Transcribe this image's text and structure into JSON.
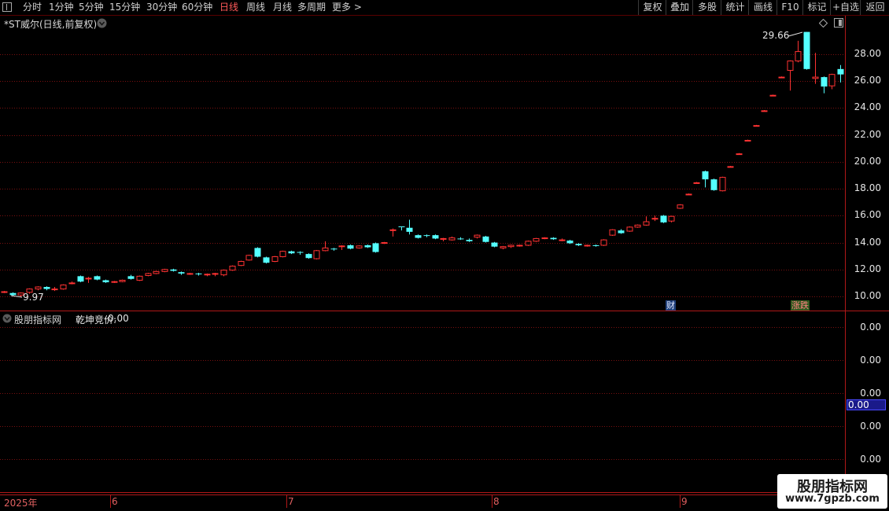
{
  "toolbar": {
    "periods": [
      "分时",
      "1分钟",
      "5分钟",
      "15分钟",
      "30分钟",
      "60分钟",
      "日线",
      "周线",
      "月线",
      "多周期",
      "更多 >"
    ],
    "active_period": "日线",
    "right_buttons": [
      "复权",
      "叠加",
      "多股",
      "统计",
      "画线",
      "F10",
      "标记",
      "+自选",
      "返回"
    ]
  },
  "main_chart": {
    "title": "*ST威尔(日线,前复权)",
    "price_axis": [
      "28.00",
      "26.00",
      "24.00",
      "22.00",
      "20.00",
      "18.00",
      "16.00",
      "14.00",
      "12.00",
      "10.00"
    ],
    "high_marker": "29.66",
    "low_marker": "9.97",
    "badge_finance": "财",
    "badge_limit": "涨跌"
  },
  "indicator_panel": {
    "title": "股朋指标网",
    "indicator_name": "乾坤竞价:",
    "indicator_value": "0.00",
    "axis_values": [
      "0.00",
      "0.00",
      "0.00",
      "0.00",
      "0.00"
    ],
    "current_value": "0.00"
  },
  "time_axis": {
    "labels": [
      "2025年",
      "6",
      "7",
      "8",
      "9"
    ]
  },
  "watermark": {
    "title": "股朋指标网",
    "url": "www.7gpzb.com"
  },
  "colors": {
    "up": "#ff3232",
    "down": "#54ffff",
    "grid": "#7a1010",
    "background": "#000000"
  },
  "candles": [
    [
      10.3,
      10.35,
      10.25,
      10.4
    ],
    [
      10.25,
      10.1,
      10.0,
      10.3
    ],
    [
      10.1,
      10.25,
      9.97,
      10.3
    ],
    [
      10.3,
      10.55,
      10.2,
      10.6
    ],
    [
      10.55,
      10.7,
      10.45,
      10.75
    ],
    [
      10.7,
      10.55,
      10.45,
      10.75
    ],
    [
      10.55,
      10.55,
      10.4,
      10.7
    ],
    [
      10.55,
      10.85,
      10.5,
      10.9
    ],
    [
      11.0,
      11.0,
      10.9,
      11.1
    ],
    [
      11.5,
      11.1,
      11.05,
      11.55
    ],
    [
      11.35,
      11.35,
      11.0,
      11.45
    ],
    [
      11.5,
      11.25,
      11.2,
      11.55
    ],
    [
      11.2,
      11.05,
      11.0,
      11.25
    ],
    [
      11.05,
      11.1,
      11.0,
      11.15
    ],
    [
      11.1,
      11.2,
      11.05,
      11.25
    ],
    [
      11.5,
      11.3,
      11.25,
      11.6
    ],
    [
      11.2,
      11.5,
      11.15,
      11.55
    ],
    [
      11.55,
      11.7,
      11.5,
      11.75
    ],
    [
      11.7,
      11.85,
      11.65,
      11.9
    ],
    [
      11.85,
      12.0,
      11.8,
      12.05
    ],
    [
      12.0,
      11.9,
      11.85,
      12.05
    ],
    [
      11.8,
      11.7,
      11.6,
      11.85
    ],
    [
      11.7,
      11.7,
      11.6,
      11.75
    ],
    [
      11.7,
      11.65,
      11.55,
      11.75
    ],
    [
      11.6,
      11.65,
      11.5,
      11.7
    ],
    [
      11.65,
      11.7,
      11.5,
      11.75
    ],
    [
      11.6,
      11.95,
      11.5,
      12.0
    ],
    [
      11.95,
      12.25,
      11.9,
      12.3
    ],
    [
      12.3,
      12.6,
      12.25,
      12.65
    ],
    [
      12.7,
      13.05,
      12.65,
      13.1
    ],
    [
      13.6,
      12.95,
      12.9,
      13.65
    ],
    [
      12.9,
      12.5,
      12.45,
      12.95
    ],
    [
      12.6,
      12.95,
      12.55,
      13.0
    ],
    [
      12.95,
      13.35,
      12.9,
      13.4
    ],
    [
      13.35,
      13.2,
      13.15,
      13.4
    ],
    [
      13.3,
      13.25,
      13.1,
      13.35
    ],
    [
      13.15,
      12.85,
      12.8,
      13.2
    ],
    [
      12.8,
      13.4,
      12.75,
      13.45
    ],
    [
      13.4,
      13.6,
      13.35,
      14.1
    ],
    [
      13.55,
      13.5,
      13.4,
      13.6
    ],
    [
      13.7,
      13.75,
      13.45,
      13.8
    ],
    [
      13.8,
      13.55,
      13.5,
      13.85
    ],
    [
      13.6,
      13.75,
      13.55,
      13.8
    ],
    [
      13.8,
      13.65,
      13.6,
      13.85
    ],
    [
      13.95,
      13.3,
      13.25,
      14.0
    ],
    [
      13.95,
      14.0,
      13.9,
      14.05
    ],
    [
      14.95,
      14.95,
      14.45,
      15.05
    ],
    [
      15.2,
      15.15,
      14.9,
      15.2
    ],
    [
      15.1,
      14.8,
      14.6,
      15.7
    ],
    [
      14.55,
      14.35,
      14.3,
      14.6
    ],
    [
      14.55,
      14.5,
      14.4,
      14.6
    ],
    [
      14.55,
      14.3,
      14.25,
      14.6
    ],
    [
      14.3,
      14.3,
      14.1,
      14.35
    ],
    [
      14.2,
      14.35,
      14.15,
      14.45
    ],
    [
      14.3,
      14.25,
      14.2,
      14.4
    ],
    [
      14.2,
      14.1,
      14.05,
      14.3
    ],
    [
      14.4,
      14.55,
      14.3,
      14.6
    ],
    [
      14.45,
      14.05,
      14.0,
      14.5
    ],
    [
      14.0,
      13.7,
      13.65,
      14.05
    ],
    [
      13.6,
      13.7,
      13.5,
      13.75
    ],
    [
      13.7,
      13.8,
      13.6,
      13.85
    ],
    [
      13.75,
      13.8,
      13.7,
      13.85
    ],
    [
      13.8,
      14.1,
      13.75,
      14.15
    ],
    [
      14.1,
      14.3,
      14.05,
      14.35
    ],
    [
      14.3,
      14.35,
      14.25,
      14.4
    ],
    [
      14.35,
      14.25,
      14.2,
      14.4
    ],
    [
      14.2,
      14.2,
      14.1,
      14.3
    ],
    [
      14.15,
      13.95,
      13.9,
      14.2
    ],
    [
      13.9,
      13.8,
      13.75,
      13.95
    ],
    [
      13.75,
      13.8,
      13.7,
      13.85
    ],
    [
      13.8,
      13.75,
      13.7,
      13.85
    ],
    [
      13.8,
      14.2,
      13.75,
      14.25
    ],
    [
      14.55,
      14.95,
      14.5,
      15.0
    ],
    [
      14.9,
      14.7,
      14.65,
      15.0
    ],
    [
      14.85,
      15.15,
      14.8,
      15.2
    ],
    [
      15.15,
      15.3,
      15.1,
      15.35
    ],
    [
      15.3,
      15.55,
      15.25,
      15.95
    ],
    [
      15.8,
      15.8,
      15.6,
      16.0
    ],
    [
      16.0,
      15.5,
      15.45,
      16.05
    ],
    [
      15.6,
      15.95,
      15.5,
      16.0
    ],
    [
      16.55,
      16.8,
      16.5,
      16.85
    ],
    [
      17.6,
      17.6,
      17.55,
      17.65
    ],
    [
      18.45,
      18.45,
      18.4,
      18.5
    ],
    [
      19.3,
      18.7,
      18.1,
      19.35
    ],
    [
      18.7,
      17.9,
      17.85,
      18.75
    ],
    [
      17.85,
      18.85,
      17.8,
      18.9
    ],
    [
      19.65,
      19.65,
      19.6,
      19.7
    ],
    [
      20.6,
      20.6,
      20.55,
      20.65
    ],
    [
      21.6,
      21.6,
      21.55,
      21.65
    ],
    [
      22.7,
      22.7,
      22.65,
      22.75
    ],
    [
      23.8,
      23.8,
      23.75,
      23.85
    ],
    [
      24.95,
      24.95,
      24.9,
      25.0
    ],
    [
      26.3,
      26.3,
      26.25,
      26.35
    ],
    [
      26.8,
      27.5,
      25.3,
      27.55
    ],
    [
      27.5,
      28.2,
      27.4,
      29.0
    ],
    [
      29.66,
      26.9,
      26.85,
      29.66
    ],
    [
      26.2,
      26.3,
      25.8,
      28.1
    ],
    [
      26.3,
      25.6,
      25.1,
      26.35
    ],
    [
      25.65,
      26.5,
      25.4,
      26.55
    ],
    [
      26.9,
      26.5,
      25.9,
      27.2
    ]
  ]
}
